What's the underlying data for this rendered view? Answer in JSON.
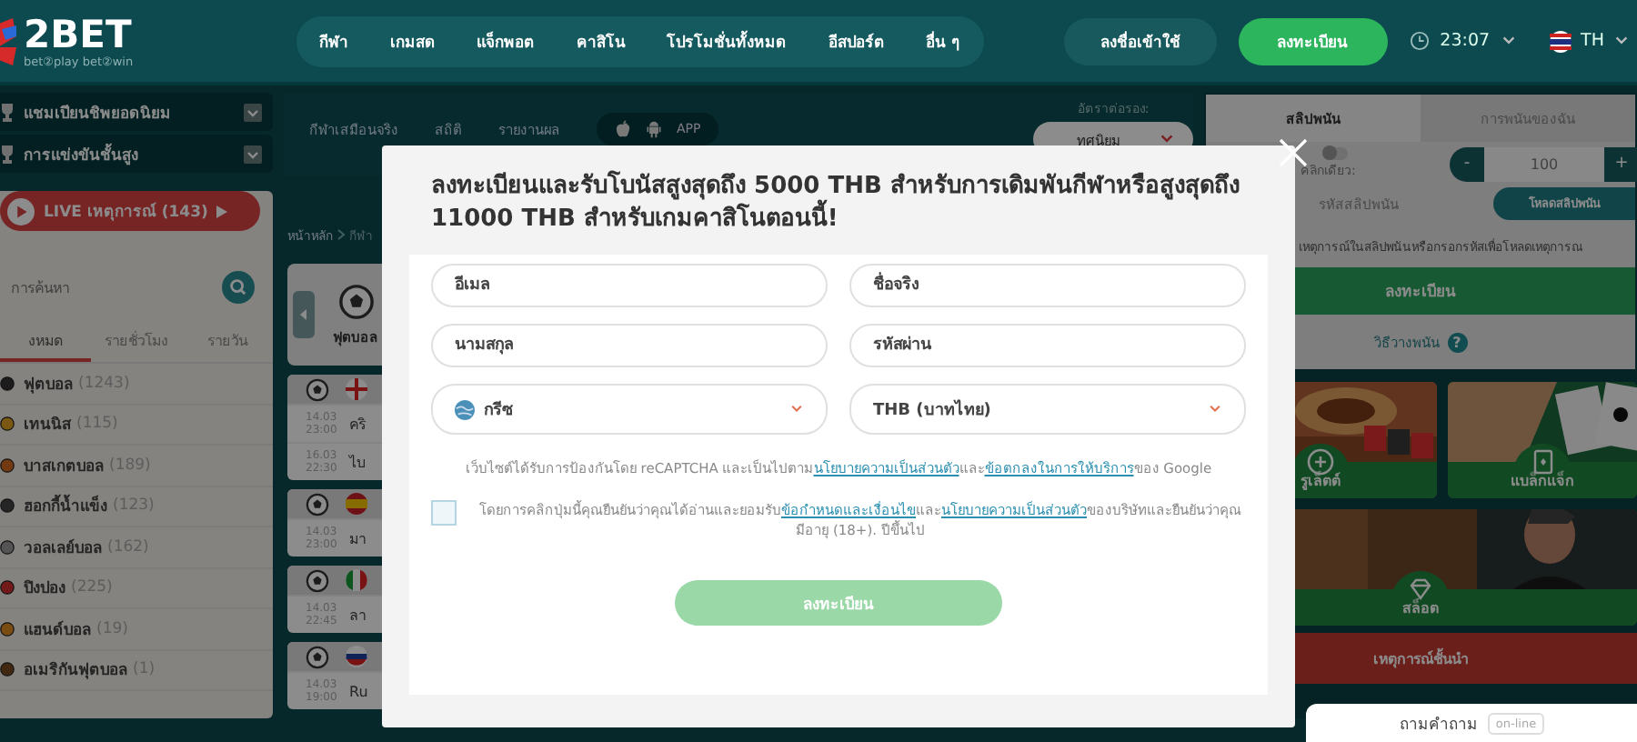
{
  "header": {
    "logo": "2BET",
    "tagline": "bet②play bet②win",
    "nav": [
      {
        "label": "กีฬา"
      },
      {
        "label": "เกมสด"
      },
      {
        "label": "แจ็กพอต"
      },
      {
        "label": "คาสิโน"
      },
      {
        "label": "โปรโมชั่นทั้งหมด"
      },
      {
        "label": "อีสปอร์ต"
      },
      {
        "label": "อื่น ๆ"
      }
    ],
    "login": "ลงชื่อเข้าใช้",
    "register": "ลงทะเบียน",
    "time": "23:07",
    "language": "TH"
  },
  "sidebar": {
    "groups": [
      {
        "label": "แชมเปียนชิพยอดนิยม"
      },
      {
        "label": "การแข่งขันชั้นสูง"
      }
    ],
    "live": "LIVE เหตุการณ์ (143)",
    "search": {
      "placeholder": "การค้นหา"
    },
    "tabs": [
      {
        "label": "งหมด",
        "selected": true
      },
      {
        "label": "รายชั่วโมง",
        "selected": false
      },
      {
        "label": "รายวัน",
        "selected": false
      }
    ],
    "sports": [
      {
        "name": "ฟุตบอล",
        "count": "(1243)",
        "kind": "football"
      },
      {
        "name": "เทนนิส",
        "count": "(115)",
        "kind": "tennis"
      },
      {
        "name": "บาสเกตบอล",
        "count": "(189)",
        "kind": "basketball"
      },
      {
        "name": "ฮอกกี้น้ำแข็ง",
        "count": "(123)",
        "kind": "hockey"
      },
      {
        "name": "วอลเลย์บอล",
        "count": "(162)",
        "kind": "volleyball"
      },
      {
        "name": "ปิงปอง",
        "count": "(225)",
        "kind": "tabletennis"
      },
      {
        "name": "แฮนด์บอล",
        "count": "(19)",
        "kind": "handball"
      },
      {
        "name": "อเมริกันฟุตบอล",
        "count": "(1)",
        "kind": "americanfootball"
      }
    ]
  },
  "center": {
    "tabs": [
      {
        "label": "กีฬาเสมือนจริง"
      },
      {
        "label": "สถิติ"
      },
      {
        "label": "รายงานผล"
      }
    ],
    "app": "APP",
    "odds": {
      "label": "อัตราต่อรอง:",
      "value": "ทศนิยม"
    },
    "breadcrumb": [
      "หน้าหลัก",
      "กีฬา"
    ],
    "sport_card": "ฟุตบอล",
    "matches": [
      {
        "kind": "england",
        "rows": [
          {
            "date": "14.03",
            "time": "23:00",
            "team": "คริ"
          },
          {
            "date": "16.03",
            "time": "22:30",
            "team": "ไบ"
          }
        ]
      },
      {
        "kind": "spain",
        "rows": [
          {
            "date": "14.03",
            "time": "23:00",
            "team": "มา"
          }
        ]
      },
      {
        "kind": "italy",
        "rows": [
          {
            "date": "14.03",
            "time": "22:45",
            "team": "ลา"
          }
        ]
      },
      {
        "kind": "russia",
        "rows": [
          {
            "date": "14.03",
            "time": "19:00",
            "team": "Ru"
          }
        ]
      }
    ]
  },
  "betslip": {
    "tabs": [
      {
        "label": "สลิปพนัน",
        "selected": true
      },
      {
        "label": "การพนันของฉัน",
        "selected": false
      }
    ],
    "one_click": {
      "label": "คลิกเดียว:",
      "on": false
    },
    "stake": {
      "minus": "-",
      "value": "100",
      "plus": "+"
    },
    "code_label": "รหัสสลิปพนัน",
    "load_button": "โหลดสลิปพนัน",
    "hint": "เหตุการณ์ในสลิปพนันหรือกรอกรหัสเพื่อโหลดเหตุการณ",
    "register": "ลงทะเบียน",
    "how_to": "วิธีวางพนัน",
    "help": "?"
  },
  "casino": [
    {
      "label": "รูเล็ตต์",
      "kind": "roulette"
    },
    {
      "label": "แบล็กแจ็ก",
      "kind": "blackjack"
    },
    {
      "label": "สล็อต",
      "kind": "slots"
    }
  ],
  "top_events": "เหตุการณ์ชั้นนำ",
  "chat": {
    "label": "ถามคำถาม",
    "status": "on-line"
  },
  "modal": {
    "title": "ลงทะเบียนและรับโบนัสสูงสุดถึง 5000 THB สำหรับการเดิมพันกีฬาหรือสูงสุดถึง 11000 THB สำหรับเกมคาสิโนตอนนี้!",
    "fields": [
      {
        "placeholder": "อีเมล"
      },
      {
        "placeholder": "ชื่อจริง"
      },
      {
        "placeholder": "นามสกุล"
      },
      {
        "placeholder": "รหัสผ่าน"
      }
    ],
    "selects": [
      {
        "kind": "country",
        "value": "กรีซ"
      },
      {
        "kind": "currency",
        "value": "THB (บาทไทย)"
      }
    ],
    "recaptcha": [
      {
        "kind": "text",
        "text": "เว็บไซต์ได้รับการป้องกันโดย reCAPTCHA และเป็นไปตาม"
      },
      {
        "kind": "link",
        "text": "นโยบายความเป็นส่วนตัว"
      },
      {
        "kind": "text",
        "text": "และ"
      },
      {
        "kind": "link",
        "text": "ข้อตกลงในการให้บริการ"
      },
      {
        "kind": "text",
        "text": "ของ Google"
      }
    ],
    "consent": {
      "checked": false,
      "parts": [
        {
          "kind": "text",
          "text": "โดยการคลิกปุ่มนี้คุณยืนยันว่าคุณได้อ่านและยอมรับ"
        },
        {
          "kind": "link",
          "text": "ข้อกำหนดและเงื่อนไข"
        },
        {
          "kind": "text",
          "text": "และ"
        },
        {
          "kind": "link",
          "text": "นโยบายความเป็นส่วนตัว"
        },
        {
          "kind": "text",
          "text": "ของบริษัทและยืนยันว่าคุณมีอายุ (18+). ปีขึ้นไป"
        }
      ]
    },
    "submit": {
      "label": "ลงทะเบียน",
      "disabled": true
    }
  }
}
